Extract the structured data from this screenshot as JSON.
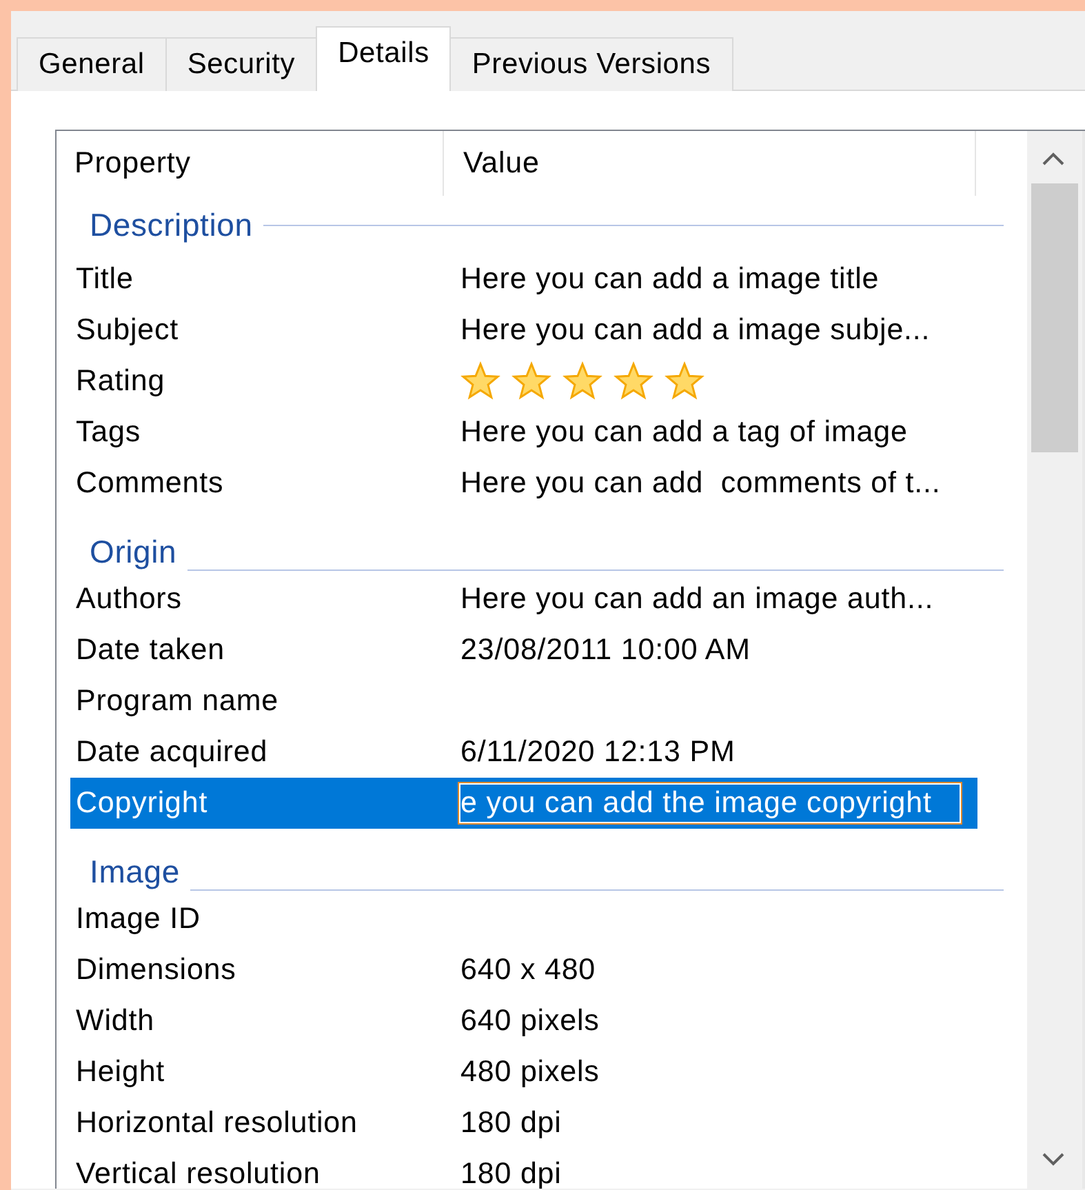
{
  "tabs": [
    {
      "label": "General",
      "selected": false
    },
    {
      "label": "Security",
      "selected": false
    },
    {
      "label": "Details",
      "selected": true
    },
    {
      "label": "Previous Versions",
      "selected": false
    }
  ],
  "columns": [
    "Property",
    "Value"
  ],
  "groups": [
    {
      "name": "Description",
      "rows": [
        {
          "kind": "text",
          "property": "Title",
          "value": "Here you can add a image title",
          "selected": false
        },
        {
          "kind": "text",
          "property": "Subject",
          "value": "Here you can add a image subje...",
          "selected": false
        },
        {
          "kind": "stars",
          "property": "Rating",
          "stars": 5,
          "selected": false
        },
        {
          "kind": "text",
          "property": "Tags",
          "value": "Here you can add a tag of image",
          "selected": false
        },
        {
          "kind": "text",
          "property": "Comments",
          "value": "Here you can add  comments of t...",
          "selected": false
        }
      ]
    },
    {
      "name": "Origin",
      "rows": [
        {
          "kind": "text",
          "property": "Authors",
          "value": "Here you can add an image auth...",
          "selected": false
        },
        {
          "kind": "text",
          "property": "Date taken",
          "value": "23/08/2011 10:00 AM",
          "selected": false
        },
        {
          "kind": "text",
          "property": "Program name",
          "selected": false
        },
        {
          "kind": "text",
          "property": "Date acquired",
          "value": "6/11/2020 12:13 PM",
          "selected": false
        },
        {
          "kind": "edit",
          "property": "Copyright",
          "value": "e you can add the image copyright",
          "selected": true
        }
      ]
    },
    {
      "name": "Image",
      "rows": [
        {
          "kind": "text",
          "property": "Image ID",
          "selected": false
        },
        {
          "kind": "text",
          "property": "Dimensions",
          "value": "640 x 480",
          "selected": false
        },
        {
          "kind": "text",
          "property": "Width",
          "value": "640 pixels",
          "selected": false
        },
        {
          "kind": "text",
          "property": "Height",
          "value": "480 pixels",
          "selected": false
        },
        {
          "kind": "text",
          "property": "Horizontal resolution",
          "value": "180 dpi",
          "selected": false
        },
        {
          "kind": "text",
          "property": "Vertical resolution",
          "value": "180 dpi",
          "selected": false
        }
      ]
    }
  ]
}
